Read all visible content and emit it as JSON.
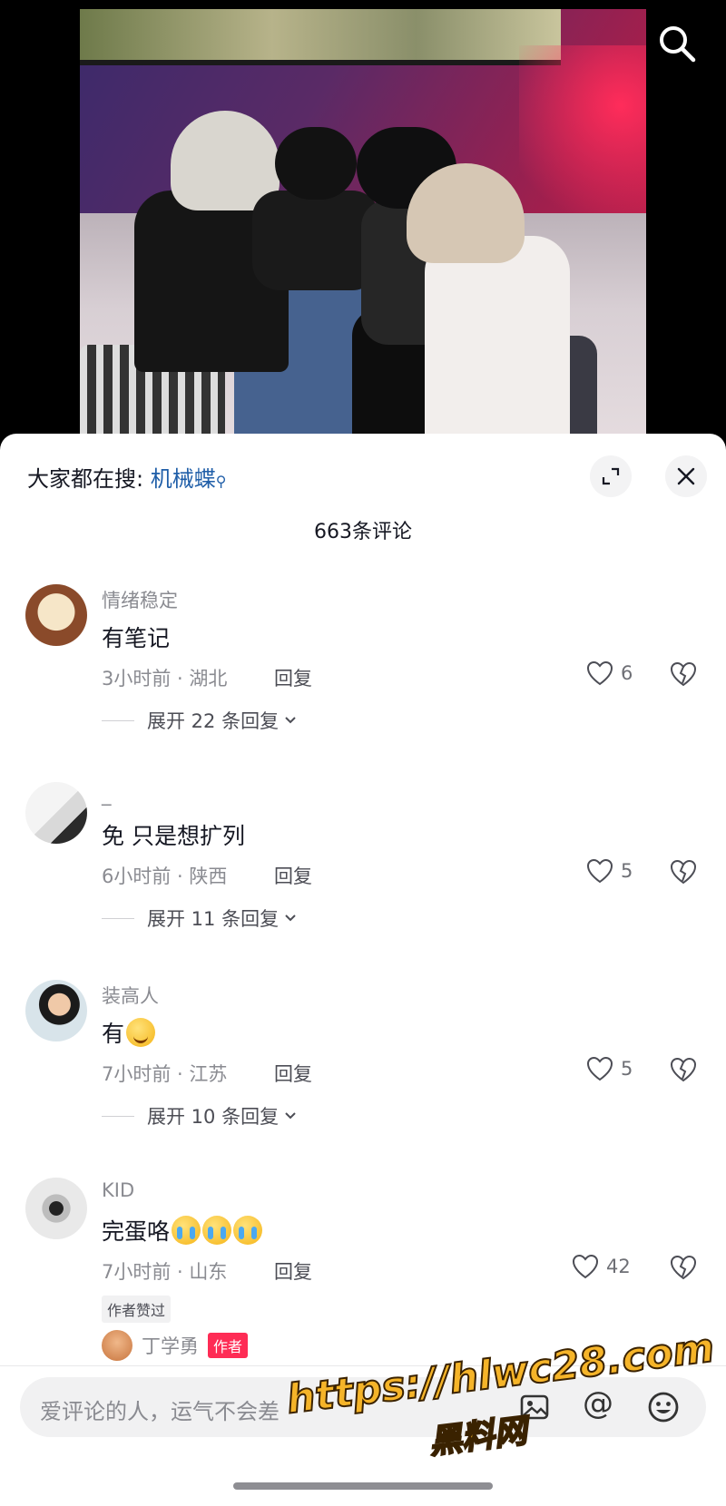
{
  "header": {
    "hot_search_prefix": "大家都在搜:",
    "hot_search_keyword": "机械蝶"
  },
  "comment_count_label": "663条评论",
  "comments": [
    {
      "username": "情绪稳定",
      "text": "有笔记",
      "meta": "3小时前 · 湖北",
      "reply_label": "回复",
      "likes": "6",
      "expand_label": "展开 22 条回复"
    },
    {
      "username": "_",
      "text": "免 只是想扩列",
      "meta": "6小时前 · 陕西",
      "reply_label": "回复",
      "likes": "5",
      "expand_label": "展开 11 条回复"
    },
    {
      "username": "装高人",
      "text": "有",
      "meta": "7小时前 · 江苏",
      "reply_label": "回复",
      "likes": "5",
      "expand_label": "展开 10 条回复"
    },
    {
      "username": "KID",
      "text": "完蛋咯",
      "meta": "7小时前 · 山东",
      "reply_label": "回复",
      "likes": "42",
      "badge": "作者赞过"
    }
  ],
  "author_reply": {
    "username": "丁学勇",
    "tag": "作者"
  },
  "input": {
    "placeholder": "爱评论的人，运气不会差"
  },
  "watermark": {
    "line1": "https://hlwc28.com",
    "line2": "黑料网"
  },
  "icons": {
    "search": "search-icon",
    "expand": "expand-icon",
    "close": "close-icon",
    "like": "heart-icon",
    "dislike": "broken-heart-icon",
    "at": "at-icon",
    "emoji": "emoji-icon"
  }
}
